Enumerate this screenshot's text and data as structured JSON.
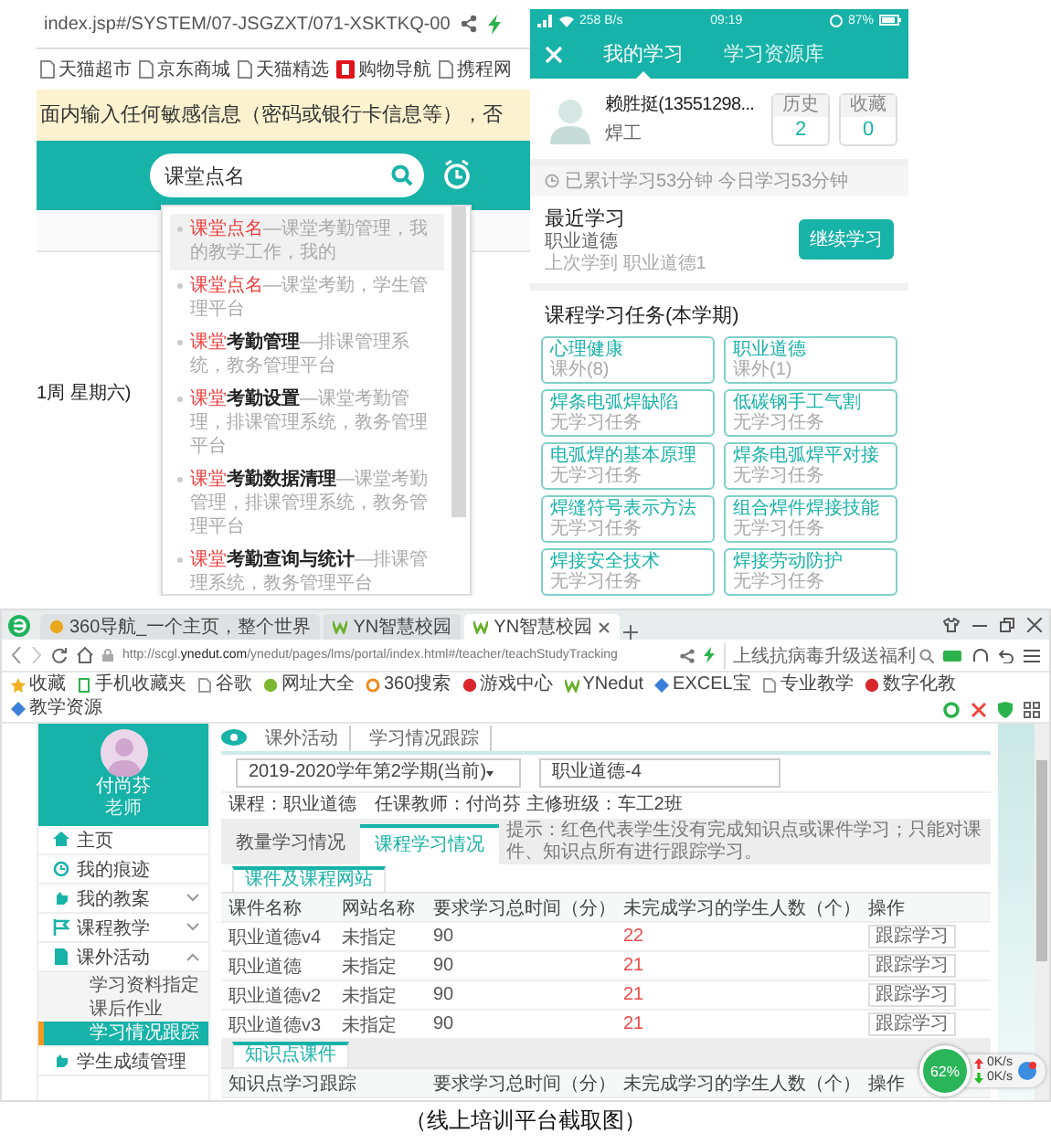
{
  "search_browser": {
    "address": "index.jsp#/SYSTEM/07-JSGZXT/071-XSKTKQ-00",
    "bookmarks": [
      {
        "label": "天猫超市",
        "kind": "page"
      },
      {
        "label": "京东商城",
        "kind": "page"
      },
      {
        "label": "天猫精选",
        "kind": "page"
      },
      {
        "label": "购物导航",
        "kind": "badge"
      },
      {
        "label": "携程网",
        "kind": "page"
      }
    ],
    "notice": "面内输入任何敏感信息（密码或银行卡信息等），否",
    "search": {
      "value": "课堂点名"
    },
    "week_label": "1周 星期六)",
    "suggestions": [
      {
        "match": "课堂点名",
        "source": "—课堂考勤管理，我的教学工作，我的",
        "selected": true
      },
      {
        "match": "课堂点名",
        "source": "—课堂考勤，学生管理平台",
        "selected": false
      },
      {
        "match": "课堂",
        "term": "考勤管理",
        "source": "—排课管理系统，教务管理平台",
        "selected": false
      },
      {
        "match": "课堂",
        "term": "考勤设置",
        "source": "—课堂考勤管理，排课管理系统，教务管理平台",
        "selected": false
      },
      {
        "match": "课堂",
        "term": "考勤数据清理",
        "source": "—课堂考勤管理，排课管理系统，教务管理平台",
        "selected": false
      },
      {
        "match": "课堂",
        "term": "考勤查询与统计",
        "source": "—排课管理系统，教务管理平台",
        "selected": false
      }
    ]
  },
  "phone": {
    "status_bar": {
      "speed": "258 B/s",
      "time": "09:19",
      "battery": "87%"
    },
    "tabs": [
      {
        "label": "我的学习",
        "selected": true
      },
      {
        "label": "学习资源库",
        "selected": false
      }
    ],
    "profile": {
      "name": "赖胜挺(13551298...",
      "role": "焊工",
      "stats": [
        {
          "label": "历史",
          "value": "2"
        },
        {
          "label": "收藏",
          "value": "0"
        }
      ]
    },
    "study_time": "已累计学习53分钟 今日学习53分钟",
    "recent": {
      "title": "最近学习",
      "course": "职业道德",
      "last": "上次学到 职业道德1",
      "button": "继续学习"
    },
    "tasks": {
      "title": "课程学习任务(本学期)",
      "courses": [
        {
          "name": "心理健康",
          "status": "课外(8)"
        },
        {
          "name": "职业道德",
          "status": "课外(1)"
        },
        {
          "name": "焊条电弧焊缺陷",
          "status": "无学习任务"
        },
        {
          "name": "低碳钢手工气割",
          "status": "无学习任务"
        },
        {
          "name": "电弧焊的基本原理",
          "status": "无学习任务"
        },
        {
          "name": "焊条电弧焊平对接",
          "status": "无学习任务"
        },
        {
          "name": "焊缝符号表示方法",
          "status": "无学习任务"
        },
        {
          "name": "组合焊件焊接技能",
          "status": "无学习任务"
        },
        {
          "name": "焊接安全技术",
          "status": "无学习任务"
        },
        {
          "name": "焊接劳动防护",
          "status": "无学习任务"
        }
      ]
    }
  },
  "lms": {
    "tabs": [
      {
        "label": "360导航_一个主页，整个世界",
        "selected": false
      },
      {
        "label": "YN智慧校园",
        "selected": false
      },
      {
        "label": "YN智慧校园",
        "selected": true
      }
    ],
    "address": "http://scgl.**ynedut.com**/ynedut/pages/lms/portal/index.html#/teacher/teachStudyTracking",
    "search": {
      "placeholder": "上线抗病毒升级送福利"
    },
    "bookmarks": [
      "收藏",
      "手机收藏夹",
      "谷歌",
      "网址大全",
      "360搜索",
      "游戏中心",
      "YNedut",
      "EXCEL宝",
      "专业教学",
      "数字化教",
      "教学资源"
    ],
    "user": {
      "name": "付尚芬",
      "role": "老师"
    },
    "nav": [
      {
        "label": "主页",
        "selected": false
      },
      {
        "label": "我的痕迹",
        "selected": false
      },
      {
        "label": "我的教案",
        "selected": false,
        "expanded": false
      },
      {
        "label": "课程教学",
        "selected": false,
        "expanded": false
      },
      {
        "label": "课外活动",
        "selected": false,
        "expanded": true,
        "children": [
          {
            "label": "学习资料指定",
            "selected": false
          },
          {
            "label": "课后作业",
            "selected": false
          },
          {
            "label": "学习情况跟踪",
            "selected": true
          }
        ]
      },
      {
        "label": "学生成绩管理",
        "selected": false
      }
    ],
    "breadcrumb": [
      "课外活动",
      "学习情况跟踪"
    ],
    "selects": [
      "2019-2020学年第2学期(当前)",
      "职业道德-4"
    ],
    "info": "课程：职业道德　任课教师：付尚芬 主修班级：车工2班",
    "tabs2": [
      {
        "label": "教量学习情况",
        "selected": false
      },
      {
        "label": "课程学习情况",
        "selected": true
      }
    ],
    "hint": "提示：红色代表学生没有完成知识点或课件学习；只能对课件、知识点所有进行跟踪学习。",
    "courseware_tab": "课件及课程网站",
    "columns": [
      "课件名称",
      "网站名称",
      "要求学习总时间（分）",
      "未完成学习的学生人数（个）",
      "操作"
    ],
    "rows": [
      {
        "cells": [
          "职业道德v4",
          "未指定",
          "90",
          "22"
        ],
        "action": "跟踪学习"
      },
      {
        "cells": [
          "职业道德",
          "未指定",
          "90",
          "21"
        ],
        "action": "跟踪学习"
      },
      {
        "cells": [
          "职业道德v2",
          "未指定",
          "90",
          "21"
        ],
        "action": "跟踪学习"
      },
      {
        "cells": [
          "职业道德v3",
          "未指定",
          "90",
          "21"
        ],
        "action": "跟踪学习"
      }
    ],
    "knowledge_tab": "知识点课件",
    "knowledge_columns": [
      "知识点学习跟踪",
      "要求学习总时间（分）",
      "未完成学习的学生人数（个）",
      "操作"
    ],
    "widget": {
      "percent": "62%",
      "upload": "0K/s",
      "download": "0K/s"
    }
  },
  "caption": "（线上培训平台截取图）"
}
